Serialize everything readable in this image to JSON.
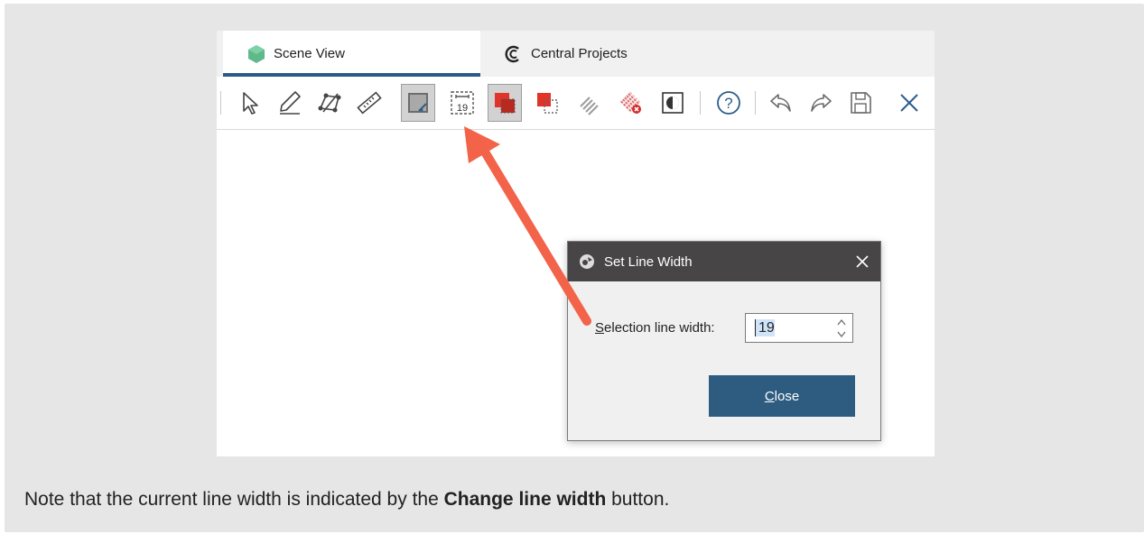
{
  "tabs": {
    "scene_view": "Scene View",
    "central_projects": "Central Projects"
  },
  "toolbar": {
    "line_width_value": "19",
    "buttons": [
      "select-tool",
      "draw-line-tool",
      "edit-line-tool",
      "measure-tool",
      "draw-selection-tool",
      "change-line-width",
      "select-tool-red",
      "unselect-tool",
      "filter-tool",
      "clear-selection",
      "invert-selection",
      "help",
      "undo",
      "redo",
      "save",
      "close"
    ]
  },
  "dialog": {
    "title": "Set Line Width",
    "label_prefix": "S",
    "label_rest": "election line width:",
    "value": "19",
    "close_prefix": "C",
    "close_rest": "lose"
  },
  "caption": {
    "text_before": "Note that the current line width is indicated by the ",
    "bold": "Change line width",
    "text_after": " button."
  },
  "colors": {
    "accent": "#2a5a86",
    "button": "#2d5c80",
    "titlebar": "#474545",
    "arrow": "#f26349",
    "red_tool": "#e0332a"
  }
}
